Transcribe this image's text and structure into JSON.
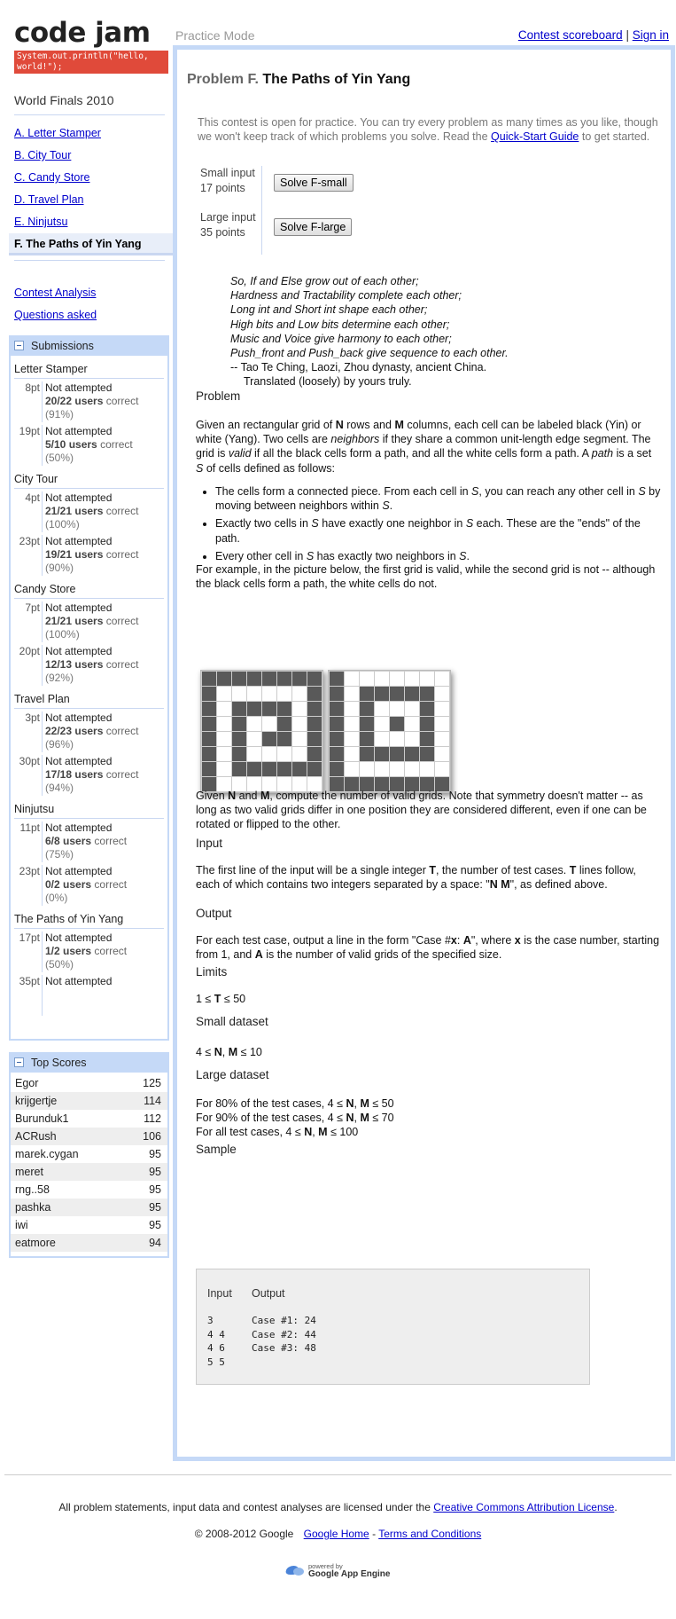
{
  "brand": {
    "title": "code jam",
    "tagline": "System.out.println(\"hello, world!\");",
    "tag_color": "#e04a3a"
  },
  "header": {
    "mode": "Practice Mode",
    "scoreboard_link": "Contest scoreboard",
    "separator": "|",
    "signin_link": "Sign in"
  },
  "sidebar": {
    "contest": "World Finals 2010",
    "problems": [
      {
        "label": "A. Letter Stamper"
      },
      {
        "label": "B. City Tour"
      },
      {
        "label": "C. Candy Store"
      },
      {
        "label": "D. Travel Plan"
      },
      {
        "label": "E. Ninjutsu"
      },
      {
        "label": "F. The Paths of Yin Yang"
      }
    ],
    "links": [
      "Contest Analysis",
      "Questions asked"
    ]
  },
  "submissions": {
    "title": "Submissions",
    "groups": [
      {
        "name": "Letter Stamper",
        "rows": [
          {
            "pts": "8pt",
            "status": "Not attempted",
            "ratio": "20/22",
            "users": "users",
            "correct": "correct",
            "pct": "(91%)"
          },
          {
            "pts": "19pt",
            "status": "Not attempted",
            "ratio": "5/10",
            "users": "users",
            "correct": "correct",
            "pct": "(50%)"
          }
        ]
      },
      {
        "name": "City Tour",
        "rows": [
          {
            "pts": "4pt",
            "status": "Not attempted",
            "ratio": "21/21",
            "users": "users",
            "correct": "correct",
            "pct": "(100%)"
          },
          {
            "pts": "23pt",
            "status": "Not attempted",
            "ratio": "19/21",
            "users": "users",
            "correct": "correct",
            "pct": "(90%)"
          }
        ]
      },
      {
        "name": "Candy Store",
        "rows": [
          {
            "pts": "7pt",
            "status": "Not attempted",
            "ratio": "21/21",
            "users": "users",
            "correct": "correct",
            "pct": "(100%)"
          },
          {
            "pts": "20pt",
            "status": "Not attempted",
            "ratio": "12/13",
            "users": "users",
            "correct": "correct",
            "pct": "(92%)"
          }
        ]
      },
      {
        "name": "Travel Plan",
        "rows": [
          {
            "pts": "3pt",
            "status": "Not attempted",
            "ratio": "22/23",
            "users": "users",
            "correct": "correct",
            "pct": "(96%)"
          },
          {
            "pts": "30pt",
            "status": "Not attempted",
            "ratio": "17/18",
            "users": "users",
            "correct": "correct",
            "pct": "(94%)"
          }
        ]
      },
      {
        "name": "Ninjutsu",
        "rows": [
          {
            "pts": "11pt",
            "status": "Not attempted",
            "ratio": "6/8",
            "users": "users",
            "correct": "correct",
            "pct": "(75%)"
          },
          {
            "pts": "23pt",
            "status": "Not attempted",
            "ratio": "0/2",
            "users": "users",
            "correct": "correct",
            "pct": "(0%)"
          }
        ]
      },
      {
        "name": "The Paths of Yin Yang",
        "rows": [
          {
            "pts": "17pt",
            "status": "Not attempted",
            "ratio": "1/2",
            "users": "users",
            "correct": "correct",
            "pct": "(50%)"
          },
          {
            "pts": "35pt",
            "status": "Not attempted",
            "ratio": "",
            "users": "",
            "correct": "",
            "pct": ""
          }
        ]
      }
    ]
  },
  "top_scores": {
    "title": "Top Scores",
    "rows": [
      {
        "name": "Egor",
        "score": "125"
      },
      {
        "name": "krijgertje",
        "score": "114"
      },
      {
        "name": "Burunduk1",
        "score": "112"
      },
      {
        "name": "ACRush",
        "score": "106"
      },
      {
        "name": "marek.cygan",
        "score": "95"
      },
      {
        "name": "meret",
        "score": "95"
      },
      {
        "name": "rng..58",
        "score": "95"
      },
      {
        "name": "pashka",
        "score": "95"
      },
      {
        "name": "iwi",
        "score": "95"
      },
      {
        "name": "eatmore",
        "score": "94"
      }
    ]
  },
  "problem": {
    "letter": "Problem F.",
    "name": "The Paths of Yin Yang",
    "notice_before": "This contest is open for practice. You can try every problem as many times as you like, though we won't keep track of which problems you solve. Read the ",
    "notice_link": "Quick-Start Guide",
    "notice_after": " to get started.",
    "inputs": [
      {
        "name": "Small input",
        "points": "17 points",
        "button": "Solve F-small"
      },
      {
        "name": "Large input",
        "points": "35 points",
        "button": "Solve F-large"
      }
    ],
    "poem": [
      "So, If and Else grow out of each other;",
      "Hardness and Tractability complete each other;",
      "Long int and Short int shape each other;",
      "High bits and Low bits determine each other;",
      "Music and Voice give harmony to each other;",
      "Push_front and Push_back give sequence to each other."
    ],
    "attribution": "-- Tao Te Ching, Laozi, Zhou dynasty, ancient China.",
    "translation": "Translated (loosely) by yours truly.",
    "sections": {
      "problem": "Problem",
      "input": "Input",
      "output": "Output",
      "limits": "Limits",
      "small": "Small dataset",
      "large": "Large dataset",
      "sample": "Sample"
    },
    "grids": [
      [
        "11111111",
        "10000001",
        "10111101",
        "10100101",
        "10101101",
        "10100001",
        "10111111",
        "10000000"
      ],
      [
        "10000000",
        "10111110",
        "10100010",
        "10101010",
        "10100010",
        "10111110",
        "10000000",
        "11111111"
      ]
    ],
    "sample_input_label": "Input",
    "sample_output_label": "Output",
    "sample_input": "3\n4 4\n4 6\n5 5",
    "sample_output": "Case #1: 24\nCase #2: 44\nCase #3: 48"
  },
  "footer": {
    "license_text": "All problem statements, input data and contest analyses are licensed under the ",
    "license_link": "Creative Commons Attribution License",
    "license_end": ".",
    "copyright": "© 2008-2012 Google",
    "google_home": "Google Home",
    "dash": "-",
    "terms": "Terms and Conditions",
    "powered_by": "powered by",
    "app_engine": "Google App Engine"
  }
}
